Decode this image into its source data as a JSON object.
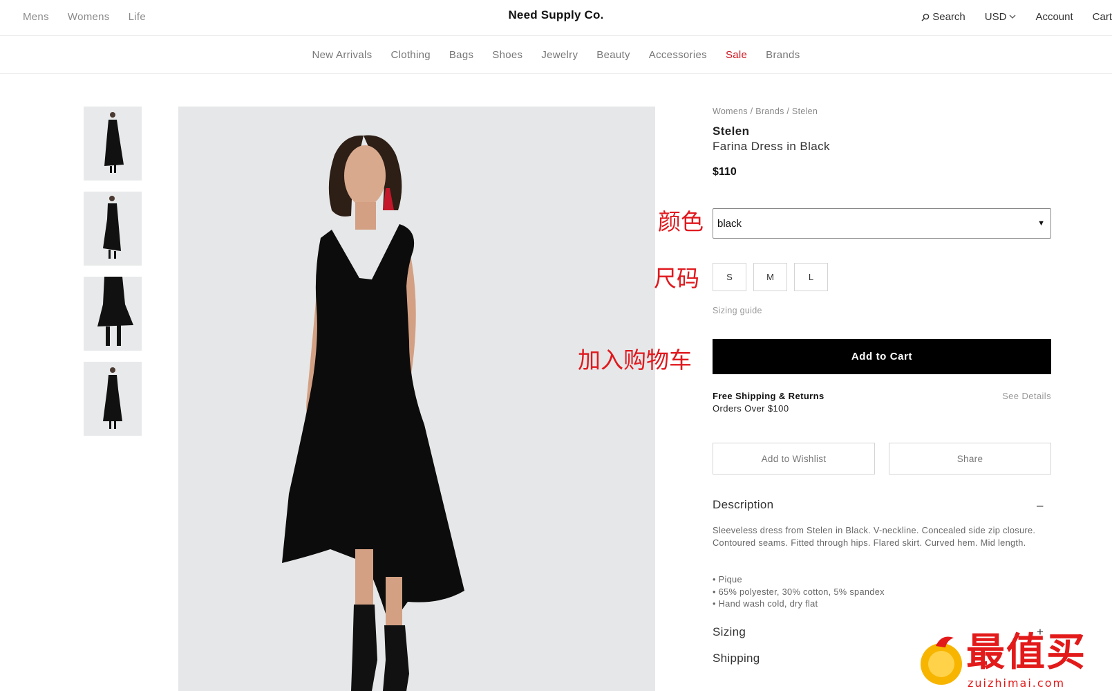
{
  "header": {
    "left_nav": [
      "Mens",
      "Womens",
      "Life"
    ],
    "brand": "Need Supply Co.",
    "search_label": "Search",
    "currency": "USD",
    "account_label": "Account",
    "cart_label": "Cart"
  },
  "categories": {
    "items": [
      "New Arrivals",
      "Clothing",
      "Bags",
      "Shoes",
      "Jewelry",
      "Beauty",
      "Accessories",
      "Sale",
      "Brands"
    ]
  },
  "annotations": {
    "color": "颜色",
    "size": "尺码",
    "add_to_cart": "加入购物车"
  },
  "product": {
    "breadcrumb": "Womens / Brands / Stelen",
    "brand": "Stelen",
    "name": "Farina Dress in Black",
    "price": "$110",
    "color_value": "black",
    "sizes": [
      "S",
      "M",
      "L"
    ],
    "sizing_guide": "Sizing guide",
    "add_to_cart": "Add to Cart",
    "shipping_title": "Free Shipping & Returns",
    "shipping_sub": "Orders Over $100",
    "see_details": "See Details",
    "wishlist": "Add to Wishlist",
    "share": "Share"
  },
  "sections": {
    "description_title": "Description",
    "description_toggle": "–",
    "description_text": "Sleeveless dress from Stelen in Black. V-neckline. Concealed side zip closure. Contoured seams. Fitted through hips. Flared skirt. Curved hem. Mid length.",
    "bullets": [
      "• Pique",
      "• 65% polyester, 30% cotton, 5% spandex",
      "• Hand wash cold, dry flat"
    ],
    "sizing_title": "Sizing",
    "sizing_toggle": "+",
    "shipping_title": "Shipping"
  },
  "watermark": {
    "text": "最值买",
    "url": "zuizhimai.com"
  },
  "colors": {
    "sale": "#d0141f",
    "annotation": "#e0191e",
    "primary_button": "#000000",
    "image_bg": "#e6e7e8"
  }
}
